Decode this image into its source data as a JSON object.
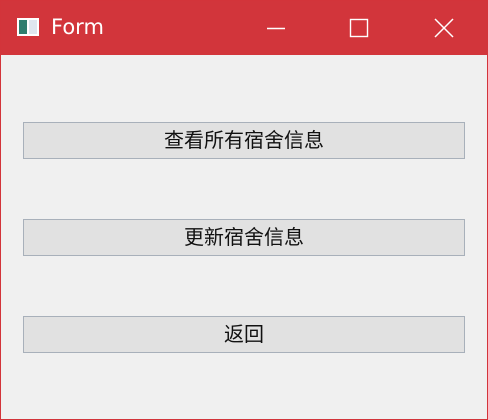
{
  "window": {
    "title": "Form",
    "titlebar_color": "#d2353b",
    "controls": [
      "minimize-icon",
      "maximize-icon",
      "close-icon"
    ]
  },
  "buttons": {
    "view_all": "查看所有宿舍信息",
    "update": "更新宿舍信息",
    "back": "返回"
  }
}
